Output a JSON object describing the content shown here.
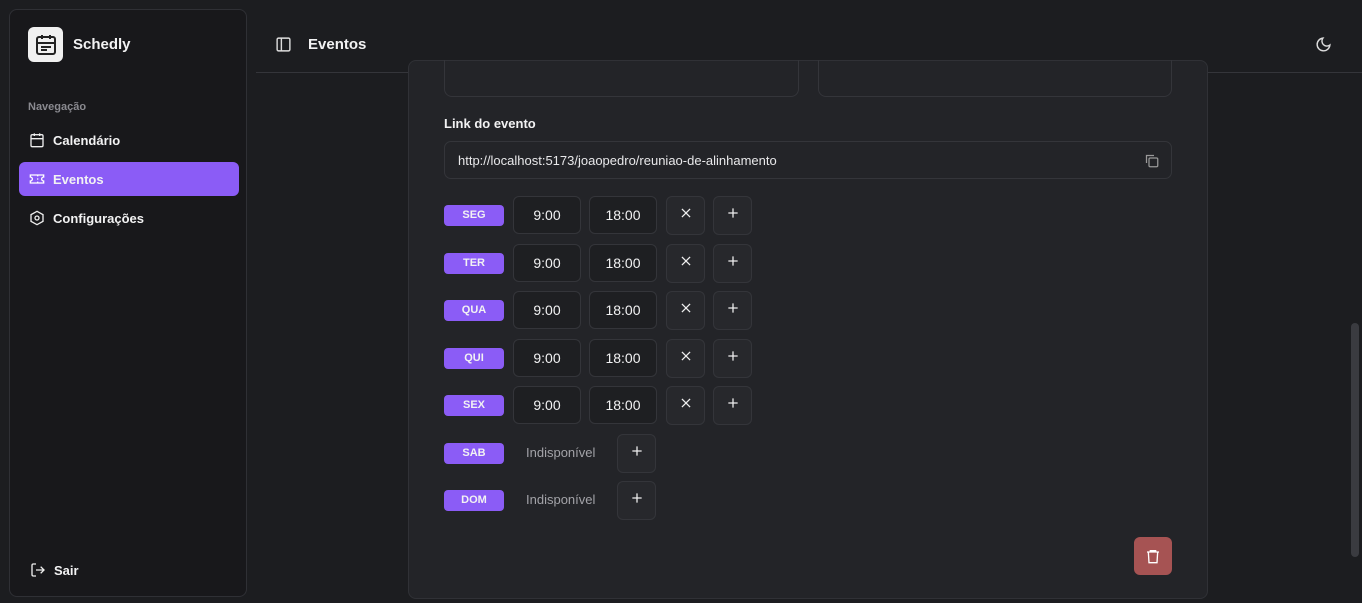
{
  "app": {
    "name": "Schedly"
  },
  "sidebar": {
    "section_label": "Navegação",
    "items": [
      {
        "label": "Calendário",
        "icon": "calendar-icon"
      },
      {
        "label": "Eventos",
        "icon": "ticket-icon",
        "active": true
      },
      {
        "label": "Configurações",
        "icon": "settings-icon"
      }
    ],
    "logout_label": "Sair"
  },
  "header": {
    "title": "Eventos"
  },
  "form": {
    "link_label": "Link do evento",
    "link_value": "http://localhost:5173/joaopedro/reuniao-de-alinhamento"
  },
  "schedule": [
    {
      "day": "SEG",
      "start": "9:00",
      "end": "18:00",
      "available": true
    },
    {
      "day": "TER",
      "start": "9:00",
      "end": "18:00",
      "available": true
    },
    {
      "day": "QUA",
      "start": "9:00",
      "end": "18:00",
      "available": true
    },
    {
      "day": "QUI",
      "start": "9:00",
      "end": "18:00",
      "available": true
    },
    {
      "day": "SEX",
      "start": "9:00",
      "end": "18:00",
      "available": true
    },
    {
      "day": "SAB",
      "available": false,
      "unavailable_label": "Indisponível"
    },
    {
      "day": "DOM",
      "available": false,
      "unavailable_label": "Indisponível"
    }
  ],
  "colors": {
    "accent": "#8b5cf6",
    "danger": "#a65353",
    "background": "#1c1d20"
  }
}
